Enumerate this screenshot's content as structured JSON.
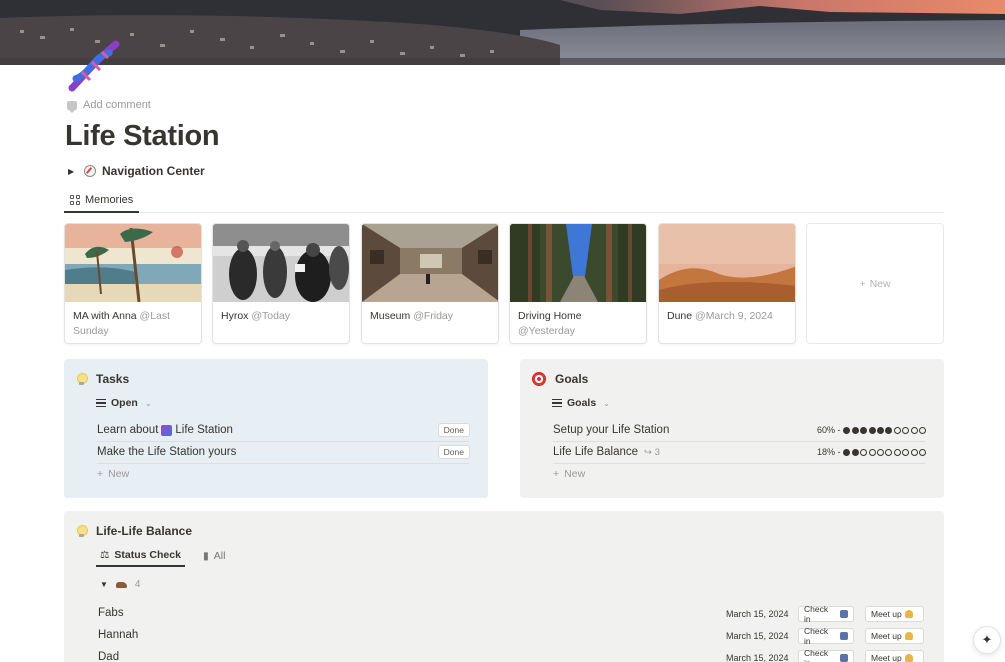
{
  "page": {
    "title": "Life Station",
    "add_comment": "Add comment",
    "icon": "dna-icon"
  },
  "toggle": {
    "label": "Navigation Center",
    "icon": "compass-icon"
  },
  "gallery": {
    "tab_label": "Memories",
    "cards": [
      {
        "title": "MA with Anna",
        "mention": "@Last Sunday",
        "image": "japanese-print-image"
      },
      {
        "title": "Hyrox",
        "mention": "@Today",
        "image": "race-runners-image"
      },
      {
        "title": "Museum",
        "mention": "@Friday",
        "image": "museum-gallery-image"
      },
      {
        "title": "Driving Home",
        "mention": "@Yesterday",
        "image": "forest-road-image"
      },
      {
        "title": "Dune",
        "mention": "@March 9, 2024",
        "image": "desert-dunes-image"
      }
    ],
    "new_label": "New"
  },
  "tasks": {
    "title": "Tasks",
    "view": "Open",
    "items": [
      {
        "before": "Learn about",
        "after": "Life Station",
        "button": "Done"
      },
      {
        "text": "Make the Life Station yours",
        "button": "Done"
      }
    ],
    "new_label": "New"
  },
  "goals": {
    "title": "Goals",
    "view": "Goals",
    "items": [
      {
        "text": "Setup your Life Station",
        "progress_label": "60% -",
        "progress": 0.6,
        "dots_filled": 6,
        "dots_total": 10
      },
      {
        "text": "Life Life Balance",
        "subitems": "3",
        "progress_label": "18% -",
        "progress": 0.18,
        "dots_filled": 2,
        "dots_total": 10
      }
    ],
    "new_label": "New"
  },
  "life_balance": {
    "title": "Life-Life Balance",
    "tabs": [
      "Status Check",
      "All"
    ],
    "group_count": "4",
    "people": [
      {
        "name": "Fabs",
        "date": "March 15, 2024",
        "check": "Check in",
        "meet": "Meet up"
      },
      {
        "name": "Hannah",
        "date": "March 15, 2024",
        "check": "Check in",
        "meet": "Meet up"
      },
      {
        "name": "Dad",
        "date": "March 15, 2024",
        "check": "Check in",
        "meet": "Meet up"
      }
    ]
  },
  "colors": {
    "text": "#37352f",
    "muted": "#9b9a97",
    "tasks_bg": "#e7eef4",
    "goals_bg": "#f1f1ef"
  }
}
